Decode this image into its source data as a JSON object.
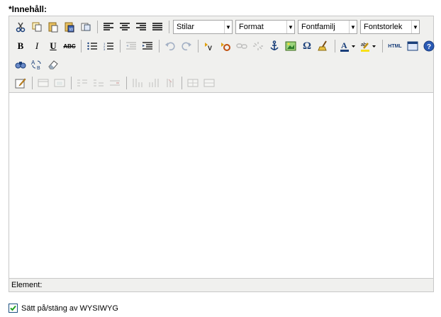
{
  "field": {
    "label": "*Innehåll:"
  },
  "toolbar": {
    "styles_select": "Stilar",
    "format_select": "Format",
    "fontfamily_select": "Fontfamilj",
    "fontsize_select": "Fontstorlek",
    "html_label": "HTML"
  },
  "statusbar": {
    "path_label": "Element:"
  },
  "wysiwyg": {
    "label": "Sätt på/stäng av WYSIWYG",
    "checked": true
  },
  "colors": {
    "toolbar_bg": "#f0f0ee",
    "border": "#c8c8c8",
    "icon": "#1a3f7a"
  }
}
